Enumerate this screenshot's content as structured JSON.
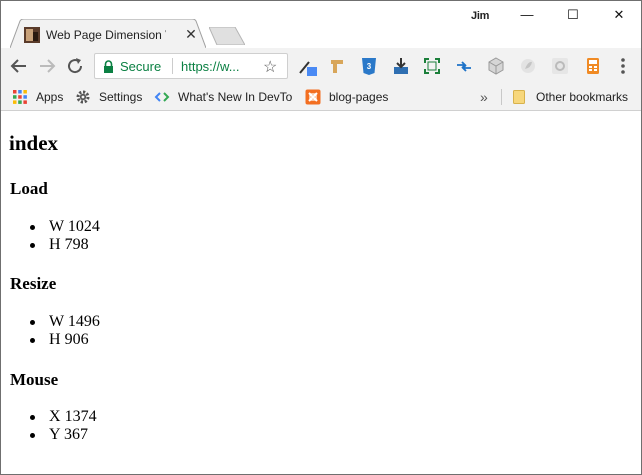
{
  "browser": {
    "tab": {
      "title": "Web Page Dimension Vie",
      "close": "✕"
    },
    "profile_name": "Jim",
    "window_controls": {
      "minimize": "—",
      "maximize": "☐",
      "close": "✕"
    },
    "omnibox": {
      "security_label": "Secure",
      "url": "https://w..."
    },
    "bookmarks": [
      {
        "label": "Apps",
        "icon": "apps-grid-icon"
      },
      {
        "label": "Settings",
        "icon": "gear-icon"
      },
      {
        "label": "What's New In DevTo",
        "icon": "devtools-icon"
      },
      {
        "label": "blog-pages",
        "icon": "blog-pages-icon"
      }
    ],
    "bookmarks_overflow": "»",
    "other_bookmarks": "Other bookmarks"
  },
  "page": {
    "title": "index",
    "sections": [
      {
        "heading": "Load",
        "items": [
          {
            "axis": "W",
            "value": "1024"
          },
          {
            "axis": "H",
            "value": "798"
          }
        ]
      },
      {
        "heading": "Resize",
        "items": [
          {
            "axis": "W",
            "value": "1496"
          },
          {
            "axis": "H",
            "value": "906"
          }
        ]
      },
      {
        "heading": "Mouse",
        "items": [
          {
            "axis": "X",
            "value": "1374"
          },
          {
            "axis": "Y",
            "value": "367"
          }
        ]
      }
    ]
  },
  "colors": {
    "secure_green": "#0b8043",
    "toolbar_bg": "#f2f2f2"
  }
}
